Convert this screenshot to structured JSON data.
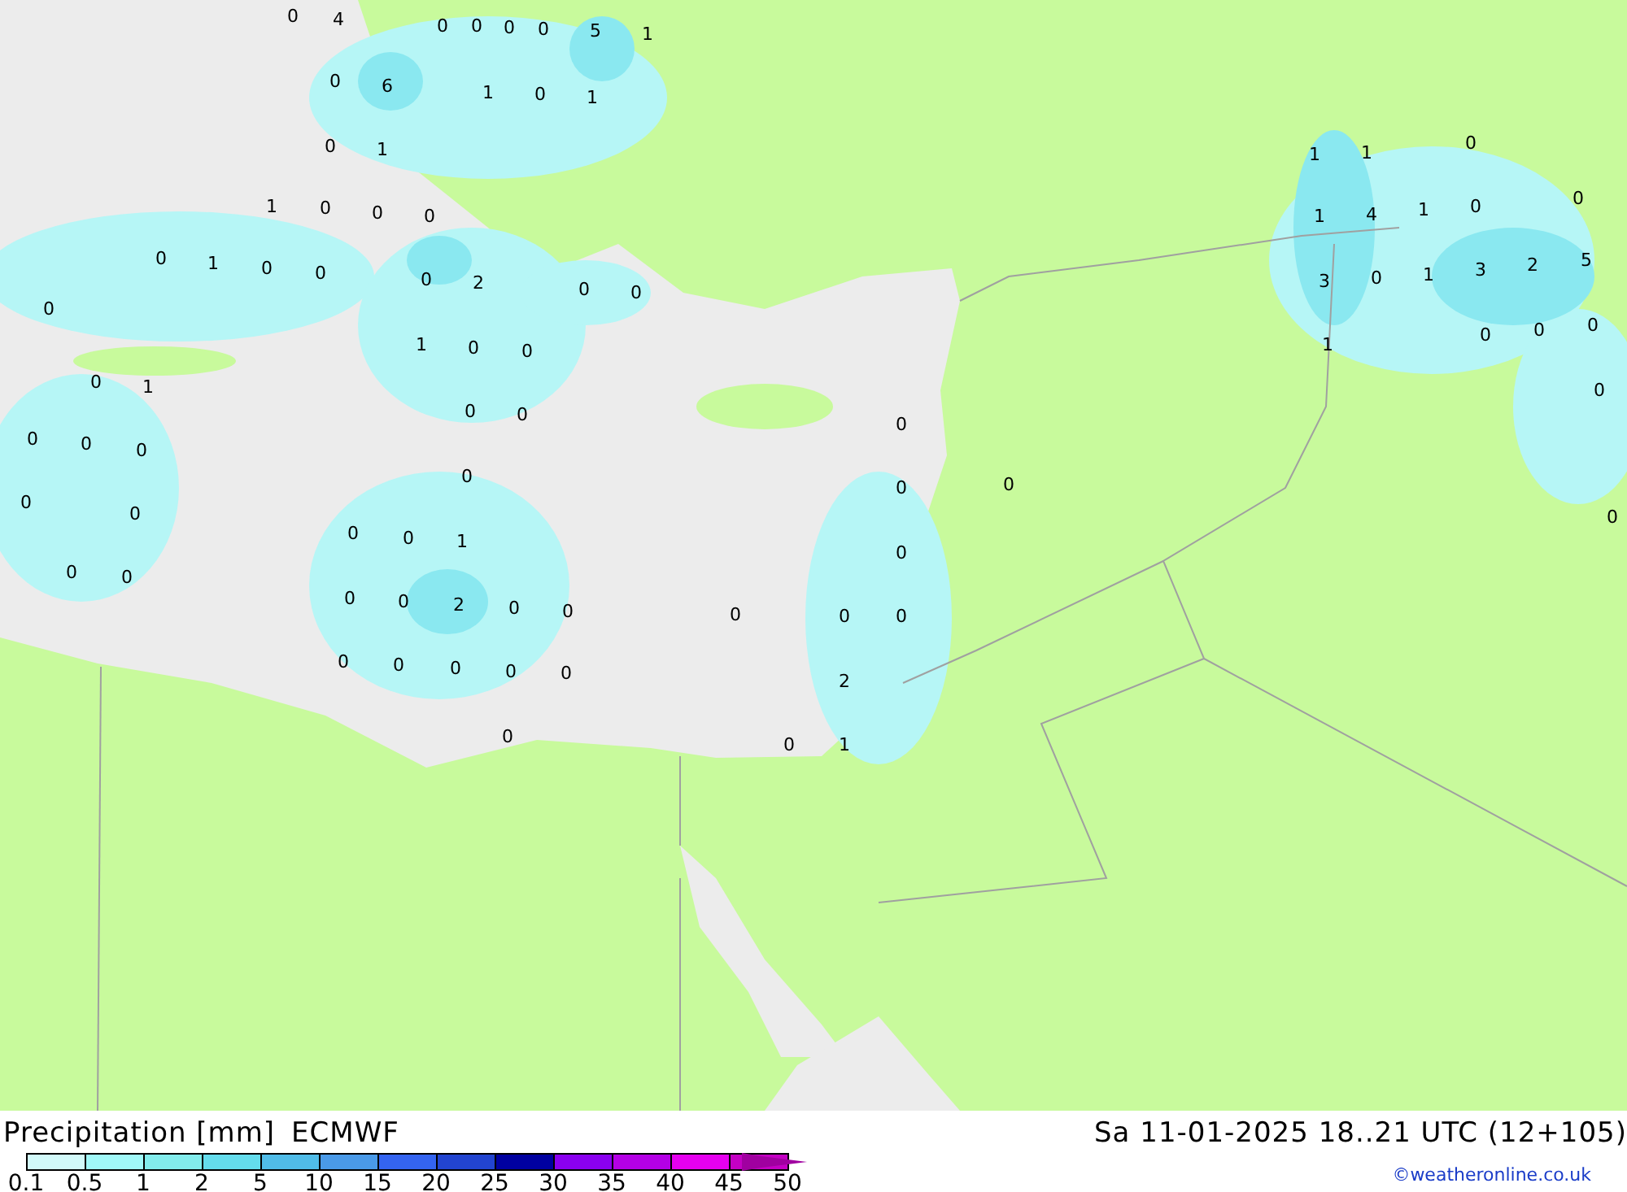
{
  "map_labels": [
    "0",
    "4",
    "0",
    "0",
    "0",
    "0",
    "5",
    "1",
    "0",
    "6",
    "1",
    "0",
    "1",
    "0",
    "1",
    "1",
    "0",
    "0",
    "0",
    "0",
    "1",
    "0",
    "0",
    "0",
    "2",
    "0",
    "0",
    "0",
    "1",
    "0",
    "0",
    "0",
    "1",
    "0",
    "0",
    "0",
    "0",
    "0",
    "0",
    "0",
    "0",
    "0",
    "0",
    "0",
    "0",
    "0",
    "1",
    "0",
    "0",
    "0",
    "0",
    "0",
    "2",
    "0",
    "0",
    "0",
    "0",
    "0",
    "0",
    "0",
    "0",
    "0",
    "0",
    "2",
    "0",
    "0",
    "1",
    "1",
    "1",
    "0",
    "1",
    "4",
    "1",
    "0",
    "0",
    "3",
    "0",
    "1",
    "3",
    "2",
    "5",
    "0",
    "0",
    "0",
    "1",
    "0",
    "0"
  ],
  "title": "Precipitation [mm]",
  "model": "ECMWF",
  "valid_time": "Sa 11-01-2025 18..21 UTC (12+105)",
  "credit": "©weatheronline.co.uk",
  "legend": [
    {
      "label": "0.1",
      "color": "#d2fafa"
    },
    {
      "label": "0.5",
      "color": "#a0f8f8"
    },
    {
      "label": "1",
      "color": "#82ecec"
    },
    {
      "label": "2",
      "color": "#64dcec"
    },
    {
      "label": "5",
      "color": "#50bce8"
    },
    {
      "label": "10",
      "color": "#4a9ae8"
    },
    {
      "label": "15",
      "color": "#3464f0"
    },
    {
      "label": "20",
      "color": "#2244d0"
    },
    {
      "label": "25",
      "color": "#0000a0"
    },
    {
      "label": "30",
      "color": "#8a00f0"
    },
    {
      "label": "35",
      "color": "#b400e6"
    },
    {
      "label": "40",
      "color": "#e600f0"
    },
    {
      "label": "45",
      "color": "#c400c4"
    },
    {
      "label": "50",
      "color": "#a000a0"
    }
  ]
}
